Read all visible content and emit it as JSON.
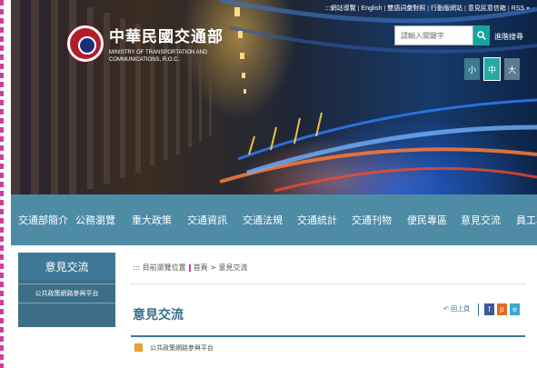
{
  "header": {
    "title_zh": "中華民國交通部",
    "title_en": "MINISTRY OF TRANSPORTATION AND COMMUNICATIONS, R.O.C.",
    "top_links": [
      ":::網站導覽",
      "English",
      "雙語詞彙對照",
      "行動版網站",
      "意見民意信箱",
      "RSS"
    ],
    "search_placeholder": "請輸入關鍵字",
    "advanced_search": "進階搜尋",
    "font_sizes": [
      "小",
      "中",
      "大"
    ]
  },
  "nav": {
    "items": [
      "交通部簡介",
      "公務瀏覽",
      "重大政策",
      "交通資訊",
      "交通法規",
      "交通統計",
      "交通刊物",
      "便民專區",
      "意見交流",
      "員工專"
    ]
  },
  "sidebar": {
    "title": "意見交流",
    "links": [
      "公共政策網路參與平台"
    ]
  },
  "breadcrumb": {
    "prefix": ":::",
    "label": "目前瀏覽位置",
    "home": "首頁",
    "separator": ">",
    "current": "意見交流"
  },
  "content": {
    "title": "意見交流",
    "prev_page": "回上頁",
    "share": [
      "f",
      "p",
      "e"
    ],
    "items": [
      "公共政策網路參與平台"
    ]
  },
  "colors": {
    "nav": "#4e8ba5",
    "sidebar": "#3d6e88",
    "accent": "#3a6f8a",
    "search_button": "#18a5a0",
    "font_small": "#3d7a8f",
    "font_medium": "#27a9a0",
    "font_large": "#5a7c90"
  },
  "icons": {
    "search": "search-icon",
    "prev": "back-arrow-icon",
    "facebook": "facebook-icon",
    "plurk": "plurk-icon",
    "share_other": "share-icon",
    "list_bullet": "document-icon"
  }
}
